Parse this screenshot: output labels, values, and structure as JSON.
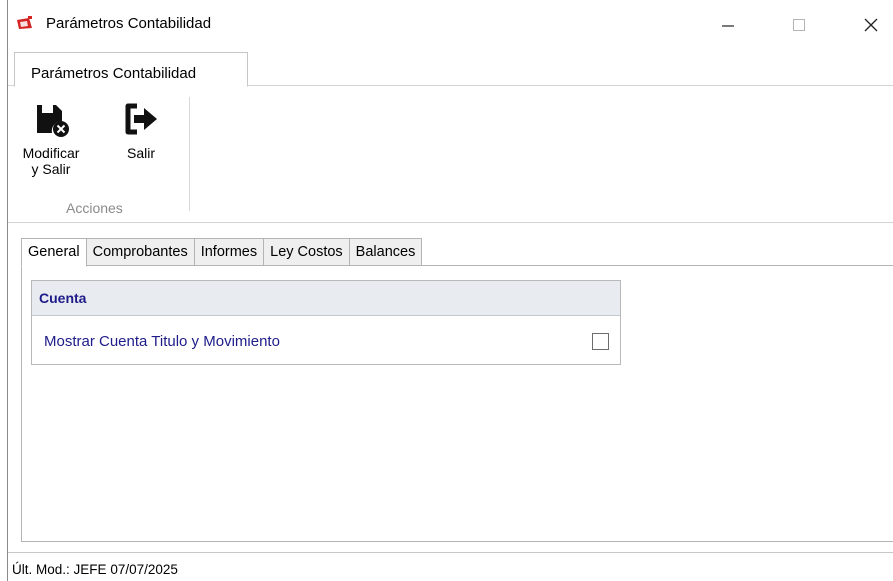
{
  "window": {
    "title": "Parámetros Contabilidad",
    "icon": "app-logo-icon",
    "controls": {
      "minimize": "minimize-icon",
      "maximize": "maximize-icon",
      "close": "close-icon"
    }
  },
  "ribbon": {
    "tab_label": "Parámetros Contabilidad",
    "group_label": "Acciones",
    "buttons": [
      {
        "label_line1": "Modificar",
        "label_line2": "y Salir",
        "icon": "save-close-icon"
      },
      {
        "label": "Salir",
        "icon": "exit-icon"
      }
    ]
  },
  "tabs": [
    "General",
    "Comprobantes",
    "Informes",
    "Ley Costos",
    "Balances"
  ],
  "active_tab": "General",
  "panel": {
    "group_title": "Cuenta",
    "option_label": "Mostrar Cuenta Titulo y Movimiento",
    "option_checked": false
  },
  "status": {
    "label": "Últ. Mod.:",
    "user": "JEFE",
    "date": "07/07/2025"
  },
  "colors": {
    "accent_text": "#1e1c8a",
    "group_header_bg": "#e8ebf0",
    "icon_red": "#d32323"
  }
}
